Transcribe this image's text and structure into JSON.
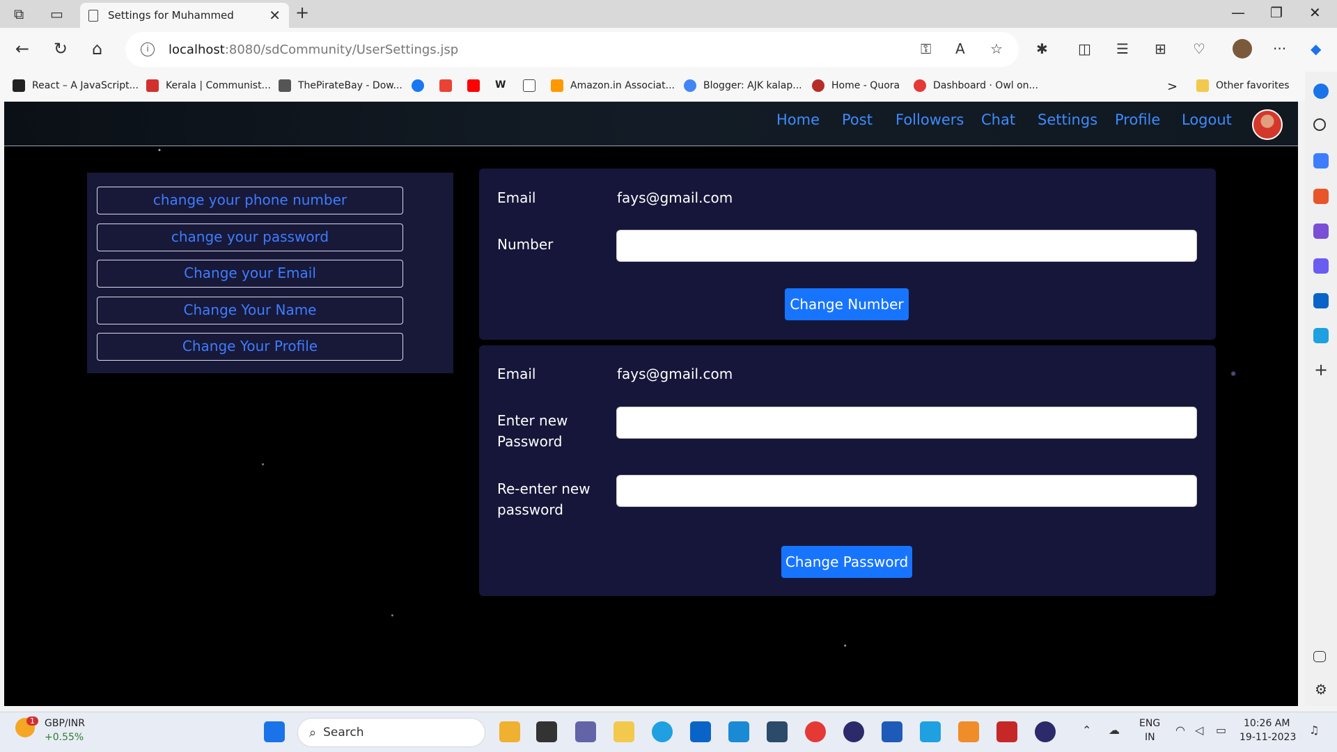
{
  "browser": {
    "tab_title": "Settings for Muhammed",
    "tab_close": "✕",
    "new_tab": "+",
    "url_host": "localhost",
    "url_path": ":8080/sdCommunity/UserSettings.jsp",
    "bookmarks": [
      {
        "label": "React – A JavaScript...",
        "color": "#222"
      },
      {
        "label": "Kerala | Communist...",
        "color": "#d32f2f"
      },
      {
        "label": "ThePirateBay - Dow...",
        "color": "#555"
      },
      {
        "label": "",
        "color": "#1877f2"
      },
      {
        "label": "",
        "color": "#ea4335"
      },
      {
        "label": "",
        "color": "#ff0000"
      },
      {
        "label": "W",
        "color": "#fff"
      },
      {
        "label": "",
        "color": "#fff"
      },
      {
        "label": "Amazon.in Associat...",
        "color": "#ff9900"
      },
      {
        "label": "Blogger: AJK kalap...",
        "color": "#4285f4"
      },
      {
        "label": "Home - Quora",
        "color": "#b92b27"
      },
      {
        "label": "Dashboard · Owl on...",
        "color": "#e53935"
      }
    ],
    "other_favorites": "Other favorites",
    "more_bookmarks": ">"
  },
  "nav": {
    "links": [
      "Home",
      "Post",
      "Followers",
      "Chat",
      "Settings",
      "Profile",
      "Logout"
    ]
  },
  "side_menu": {
    "items": [
      "change your phone number",
      "change your password",
      "Change your Email",
      "Change Your Name",
      "Change Your Profile"
    ]
  },
  "phone_form": {
    "email_label": "Email",
    "email_value": "fays@gmail.com",
    "number_label": "Number",
    "number_value": "",
    "submit_label": "Change Number"
  },
  "password_form": {
    "email_label": "Email",
    "email_value": "fays@gmail.com",
    "new_password_label": "Enter new Password",
    "reenter_label": "Re-enter new password",
    "submit_label": "Change Password"
  },
  "taskbar": {
    "ticker_name": "GBP/INR",
    "ticker_change": "+0.55%",
    "ticker_badge": "1",
    "search_placeholder": "Search",
    "lang_line1": "ENG",
    "lang_line2": "IN",
    "time": "10:26 AM",
    "date": "19-11-2023"
  }
}
